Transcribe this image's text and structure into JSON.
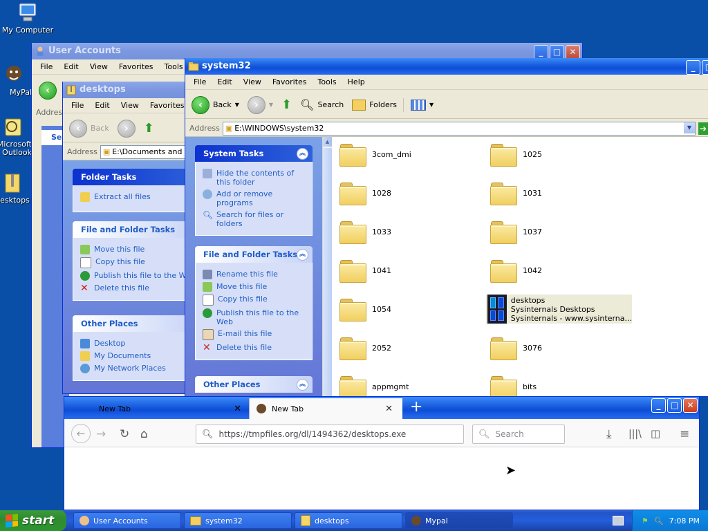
{
  "desktop": {
    "icons": [
      {
        "label": "My Computer"
      },
      {
        "label": "MyPal"
      },
      {
        "label": "Microsoft Outlook"
      },
      {
        "label": "desktops"
      }
    ]
  },
  "user_accounts": {
    "title": "User Accounts",
    "menu": [
      "File",
      "Edit",
      "View",
      "Favorites",
      "Tools"
    ],
    "address_label": "Addres",
    "pane_partial": "Se"
  },
  "desktops_win": {
    "title": "desktops",
    "menu": [
      "File",
      "Edit",
      "View",
      "Favorites"
    ],
    "back": "Back",
    "address_label": "Address",
    "address": "E:\\Documents and Se",
    "folder_tasks": {
      "header": "Folder Tasks",
      "items": [
        "Extract all files"
      ]
    },
    "file_tasks": {
      "header": "File and Folder Tasks",
      "items": [
        "Move this file",
        "Copy this file",
        "Publish this file to the Web",
        "Delete this file"
      ]
    },
    "other_places": {
      "header": "Other Places",
      "items": [
        "Desktop",
        "My Documents",
        "My Network Places"
      ]
    }
  },
  "system32": {
    "title": "system32",
    "menu": [
      "File",
      "Edit",
      "View",
      "Favorites",
      "Tools",
      "Help"
    ],
    "back": "Back",
    "search": "Search",
    "folders": "Folders",
    "address_label": "Address",
    "address": "E:\\WINDOWS\\system32",
    "system_tasks": {
      "header": "System Tasks",
      "items": [
        "Hide the contents of this folder",
        "Add or remove programs",
        "Search for files or folders"
      ]
    },
    "file_tasks": {
      "header": "File and Folder Tasks",
      "items": [
        "Rename this file",
        "Move this file",
        "Copy this file",
        "Publish this file to the Web",
        "E-mail this file",
        "Delete this file"
      ]
    },
    "other_places": {
      "header": "Other Places"
    },
    "items": [
      {
        "name": "3com_dmi"
      },
      {
        "name": "1025"
      },
      {
        "name": "1028"
      },
      {
        "name": "1031"
      },
      {
        "name": "1033"
      },
      {
        "name": "1037"
      },
      {
        "name": "1041"
      },
      {
        "name": "1042"
      },
      {
        "name": "1054"
      },
      {
        "name": "desktops",
        "line2": "Sysinternals Desktops",
        "line3": "Sysinternals - www.sysinterna..."
      },
      {
        "name": "2052"
      },
      {
        "name": "3076"
      },
      {
        "name": "appmgmt"
      },
      {
        "name": "bits"
      }
    ]
  },
  "firefox": {
    "tab1": "New Tab",
    "tab2": "New Tab",
    "url": "https://tmpfiles.org/dl/1494362/desktops.exe",
    "search_placeholder": "Search"
  },
  "taskbar": {
    "start": "start",
    "tasks": [
      "User Accounts",
      "system32",
      "desktops",
      "Mypal"
    ],
    "clock": "7:08 PM"
  },
  "colors": {
    "xp_blue": "#0c4ed6",
    "task_link": "#215dc6",
    "desktop_bg": "#0a4fa7"
  }
}
